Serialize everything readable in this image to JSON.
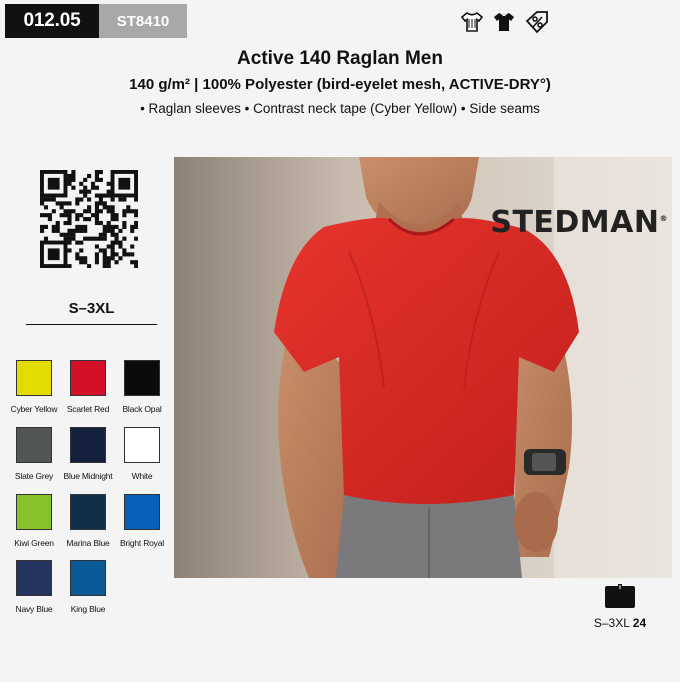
{
  "header": {
    "code": "012.05",
    "sku": "ST8410"
  },
  "care_icons": [
    "tshirt-outline-icon",
    "tshirt-filled-icon",
    "percent-tag-icon"
  ],
  "product": {
    "title": "Active 140 Raglan Men",
    "subtitle": "140 g/m² | 100% Polyester (bird-eyelet mesh, ACTIVE-DRY°)",
    "features": "• Raglan sleeves • Contrast neck tape (Cyber Yellow) • Side seams"
  },
  "size_range": "S–3XL",
  "colors": [
    {
      "name": "Cyber Yellow",
      "hex": "#e4dc00"
    },
    {
      "name": "Scarlet Red",
      "hex": "#d21128"
    },
    {
      "name": "Black Opal",
      "hex": "#0a0a0a"
    },
    {
      "name": "Slate Grey",
      "hex": "#525654"
    },
    {
      "name": "Blue Midnight",
      "hex": "#14213d"
    },
    {
      "name": "White",
      "hex": "#ffffff"
    },
    {
      "name": "Kiwi Green",
      "hex": "#86c22b"
    },
    {
      "name": "Marina Blue",
      "hex": "#10304a"
    },
    {
      "name": "Bright Royal",
      "hex": "#0761b8"
    },
    {
      "name": "Navy Blue",
      "hex": "#25345f"
    },
    {
      "name": "King Blue",
      "hex": "#0a5a98"
    }
  ],
  "photo": {
    "brand": "STEDMAN",
    "shirt_color": "#dc2b26"
  },
  "fit": {
    "range": "S–3XL",
    "count": "24"
  }
}
